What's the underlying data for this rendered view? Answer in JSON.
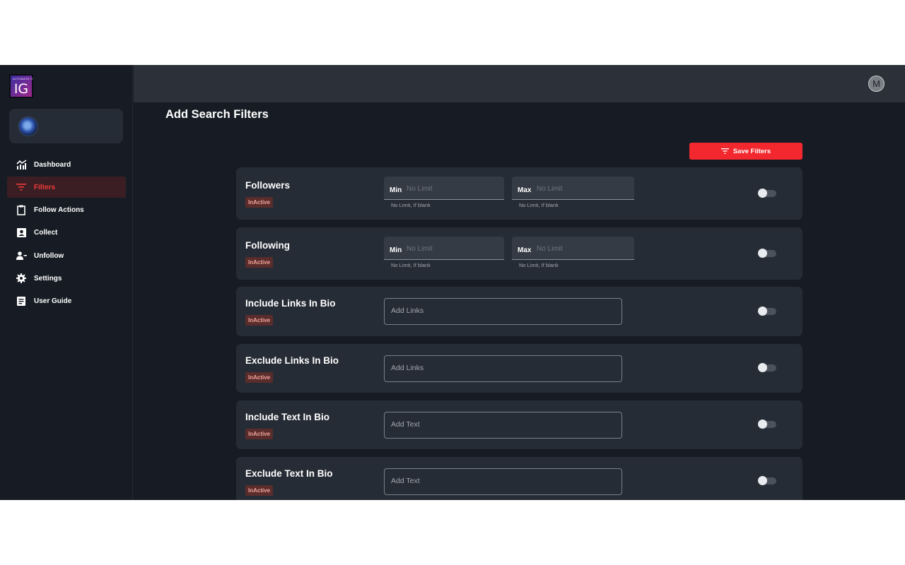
{
  "logo": {
    "small_text": "AUTOMATE.IT",
    "letters": "IG"
  },
  "sidebar": {
    "items": [
      {
        "label": "Dashboard",
        "icon": "chart-trend-icon"
      },
      {
        "label": "Filters",
        "icon": "filter-icon",
        "active": true
      },
      {
        "label": "Follow Actions",
        "icon": "clipboard-icon"
      },
      {
        "label": "Collect",
        "icon": "account-box-icon"
      },
      {
        "label": "Unfollow",
        "icon": "person-remove-icon"
      },
      {
        "label": "Settings",
        "icon": "gear-icon"
      },
      {
        "label": "User Guide",
        "icon": "document-icon"
      }
    ]
  },
  "header": {
    "user_initial": "M"
  },
  "main": {
    "title": "Add Search Filters",
    "save_button": "Save Filters",
    "filters": [
      {
        "title": "Followers",
        "status": "InActive",
        "type": "range",
        "min_label": "Min",
        "min_placeholder": "No Limit",
        "min_help": "No Limit, If blank",
        "max_label": "Max",
        "max_placeholder": "No Limit",
        "max_help": "No Limit, If blank",
        "enabled": false
      },
      {
        "title": "Following",
        "status": "InActive",
        "type": "range",
        "min_label": "Min",
        "min_placeholder": "No Limit",
        "min_help": "No Limit, If blank",
        "max_label": "Max",
        "max_placeholder": "No Limit",
        "max_help": "No Limit, If blank",
        "enabled": false
      },
      {
        "title": "Include Links In Bio",
        "status": "InActive",
        "type": "text",
        "placeholder": "Add Links",
        "enabled": false
      },
      {
        "title": "Exclude Links In Bio",
        "status": "InActive",
        "type": "text",
        "placeholder": "Add Links",
        "enabled": false
      },
      {
        "title": "Include Text In Bio",
        "status": "InActive",
        "type": "text",
        "placeholder": "Add Text",
        "enabled": false
      },
      {
        "title": "Exclude Text In Bio",
        "status": "InActive",
        "type": "text",
        "placeholder": "Add Text",
        "enabled": false
      }
    ]
  },
  "colors": {
    "accent": "#f3282e",
    "background": "#171c24",
    "card": "#262c35",
    "topbar": "#2c3139"
  }
}
